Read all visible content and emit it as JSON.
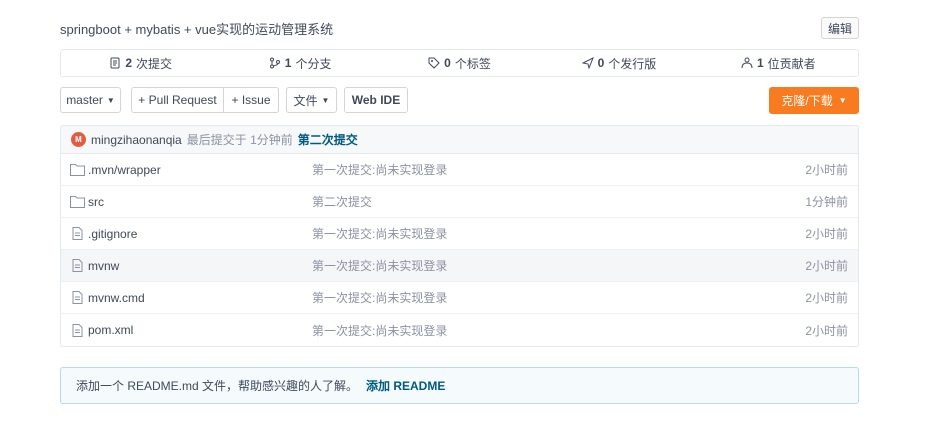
{
  "repo": {
    "description": "springboot + mybatis + vue实现的运动管理系统",
    "edit_label": "编辑"
  },
  "stats": [
    {
      "icon": "commit-icon",
      "count": "2",
      "label": "次提交"
    },
    {
      "icon": "branch-icon",
      "count": "1",
      "label": "个分支"
    },
    {
      "icon": "tag-icon",
      "count": "0",
      "label": "个标签"
    },
    {
      "icon": "release-icon",
      "count": "0",
      "label": "个发行版"
    },
    {
      "icon": "contributors-icon",
      "count": "1",
      "label": "位贡献者"
    }
  ],
  "toolbar": {
    "branch": "master",
    "pull_request": "+ Pull Request",
    "issue": "+ Issue",
    "file_menu": "文件",
    "web_ide": "Web IDE",
    "clone": "克隆/下载"
  },
  "last_commit": {
    "avatar_letter": "M",
    "author": "mingzihaonanqia",
    "meta": "最后提交于 1分钟前",
    "message": "第二次提交"
  },
  "files": [
    {
      "type": "folder",
      "name": ".mvn/wrapper",
      "message": "第一次提交:尚未实现登录",
      "time": "2小时前"
    },
    {
      "type": "folder",
      "name": "src",
      "message": "第二次提交",
      "time": "1分钟前"
    },
    {
      "type": "file",
      "name": ".gitignore",
      "message": "第一次提交:尚未实现登录",
      "time": "2小时前"
    },
    {
      "type": "file",
      "name": "mvnw",
      "message": "第一次提交:尚未实现登录",
      "time": "2小时前"
    },
    {
      "type": "file",
      "name": "mvnw.cmd",
      "message": "第一次提交:尚未实现登录",
      "time": "2小时前"
    },
    {
      "type": "file",
      "name": "pom.xml",
      "message": "第一次提交:尚未实现登录",
      "time": "2小时前"
    }
  ],
  "readme": {
    "hint": "添加一个 README.md 文件，帮助感兴趣的人了解。",
    "link": "添加 README"
  },
  "colors": {
    "accent": "#f87b20",
    "link": "#005980"
  }
}
